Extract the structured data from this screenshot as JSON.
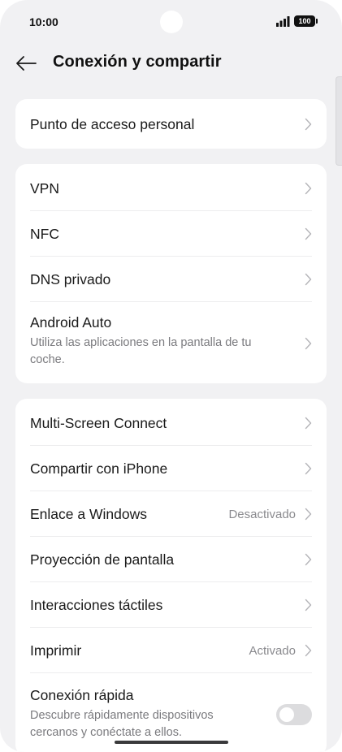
{
  "status_bar": {
    "time": "10:00",
    "battery": "100",
    "icons": [
      "signal-icon",
      "battery-icon"
    ]
  },
  "header": {
    "title": "Conexión y compartir",
    "back_icon": "back-arrow-icon"
  },
  "groups": [
    {
      "items": [
        {
          "label": "Punto de acceso personal",
          "chevron": true
        }
      ]
    },
    {
      "items": [
        {
          "label": "VPN",
          "chevron": true
        },
        {
          "label": "NFC",
          "chevron": true
        },
        {
          "label": "DNS privado",
          "chevron": true
        },
        {
          "label": "Android Auto",
          "subtitle": "Utiliza las aplicaciones en la pantalla de tu coche.",
          "chevron": true
        }
      ]
    },
    {
      "items": [
        {
          "label": "Multi-Screen Connect",
          "chevron": true
        },
        {
          "label": "Compartir con iPhone",
          "chevron": true
        },
        {
          "label": "Enlace a Windows",
          "value": "Desactivado",
          "chevron": true
        },
        {
          "label": "Proyección de pantalla",
          "chevron": true
        },
        {
          "label": "Interacciones táctiles",
          "chevron": true
        },
        {
          "label": "Imprimir",
          "value": "Activado",
          "chevron": true
        },
        {
          "label": "Conexión rápida",
          "subtitle": "Descubre rápidamente dispositivos cercanos y conéctate a ellos.",
          "toggle": "off"
        }
      ]
    }
  ],
  "colors": {
    "background": "#f1f1f3",
    "card": "#ffffff",
    "primary_text": "#1a1a1a",
    "secondary_text": "#7a7a7e",
    "divider": "#ececee",
    "toggle_off": "#dcdcde"
  }
}
